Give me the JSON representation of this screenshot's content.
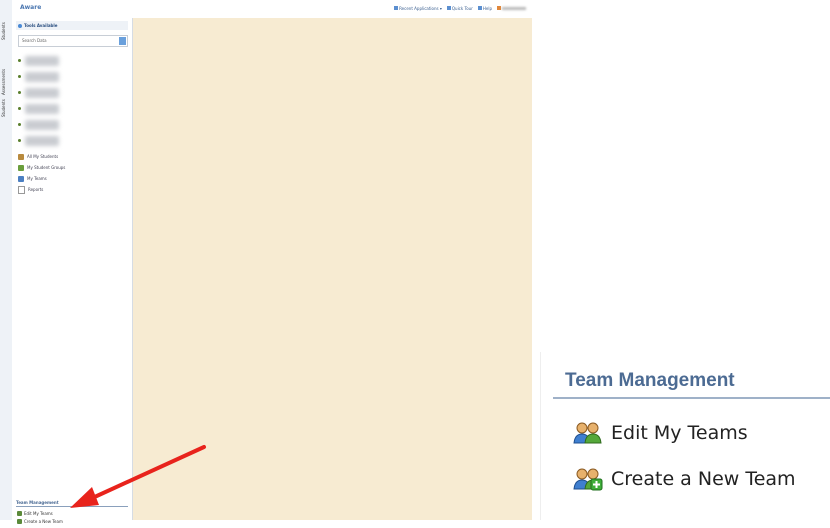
{
  "screenshot": {
    "vertical_tabs": [
      "Students",
      "Assessments",
      "Students"
    ],
    "app_title": "Aware",
    "top_links": [
      "Recent Applications ▾",
      "Quick Tour",
      "Help"
    ],
    "sidebar": {
      "tools_header": "Tools Available",
      "search_placeholder": "Search Data",
      "nav_items": [
        {
          "label": "All My Students",
          "icon": "group-icon"
        },
        {
          "label": "My Student Groups",
          "icon": "student-groups-icon"
        },
        {
          "label": "My Teams",
          "icon": "teams-icon"
        },
        {
          "label": "Reports",
          "icon": "document-icon"
        }
      ],
      "team_management": {
        "header": "Team Management",
        "items": [
          "Edit My Teams",
          "Create a New Team"
        ]
      }
    }
  },
  "zoom_panel": {
    "header": "Team Management",
    "items": [
      {
        "label": "Edit My Teams",
        "icon": "team-edit-icon"
      },
      {
        "label": "Create a New Team",
        "icon": "team-add-icon"
      }
    ]
  },
  "colors": {
    "content_bg": "#f7ebd2",
    "header_text": "#4c6b93",
    "arrow": "#e8231c"
  }
}
